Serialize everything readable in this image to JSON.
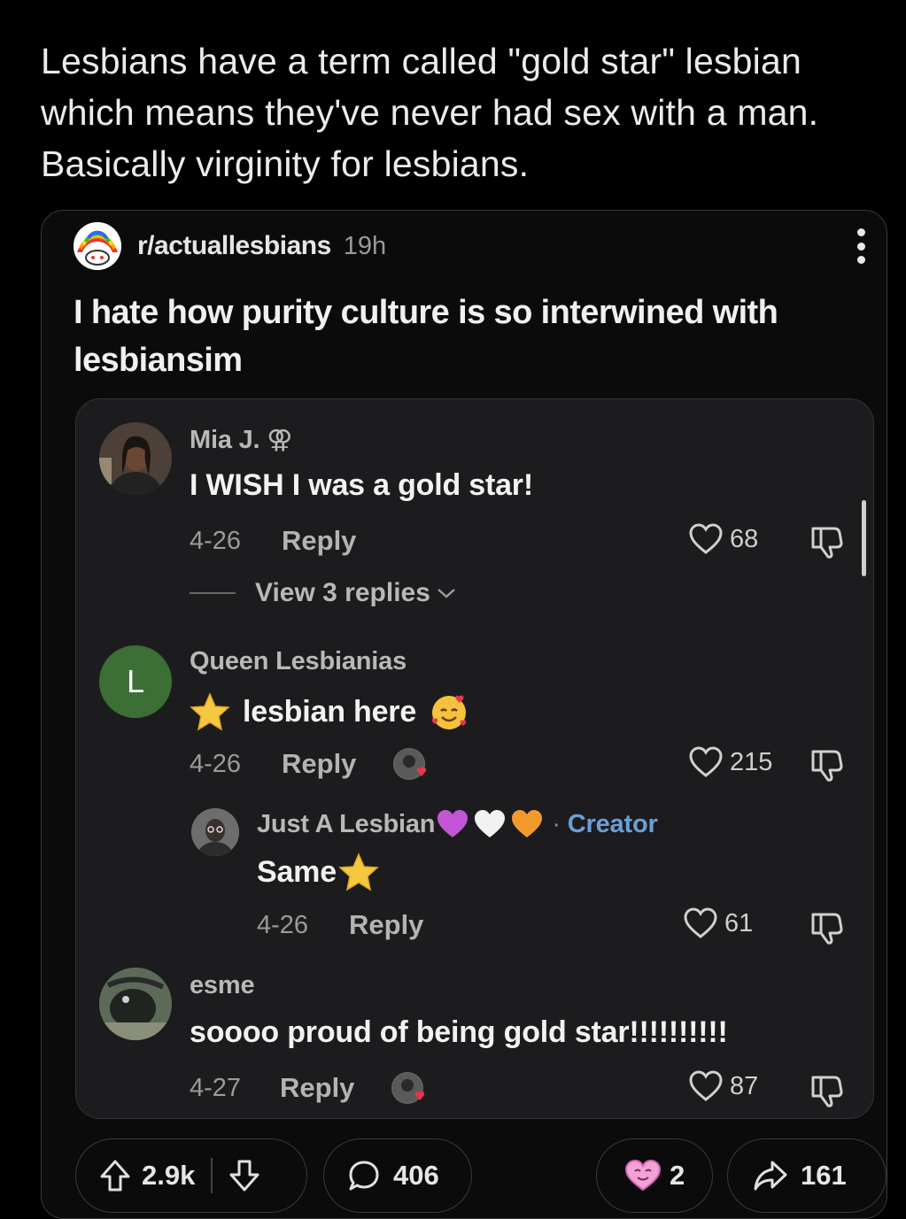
{
  "tweet": {
    "text": "Lesbians have a term called \"gold star\" lesbian which means they've never had sex with a man. Basically virginity for lesbians."
  },
  "post": {
    "subreddit": "r/actuallesbians",
    "time": "19h",
    "title": "I hate how purity culture is so interwined with lesbiansim"
  },
  "comments": [
    {
      "author": "Mia J. ⚢",
      "text": "I WISH I was a gold star!",
      "date": "4-26",
      "reply_label": "Reply",
      "likes": "68",
      "view_replies": "View 3 replies"
    },
    {
      "author": "Queen Lesbianias",
      "avatar_letter": "L",
      "text": "lesbian here",
      "date": "4-26",
      "reply_label": "Reply",
      "likes": "215"
    },
    {
      "author": "Just A Lesbian",
      "creator_label": "Creator",
      "separator": "·",
      "text": "Same",
      "date": "4-26",
      "reply_label": "Reply",
      "likes": "61"
    },
    {
      "author": "esme",
      "text": "soooo proud of being gold star!!!!!!!!!!",
      "date": "4-27",
      "reply_label": "Reply",
      "likes": "87"
    }
  ],
  "actions": {
    "upvotes": "2.9k",
    "comments": "406",
    "awards": "2",
    "shares": "161"
  },
  "colors": {
    "background": "#000000",
    "card": "#0b0b0c",
    "thread": "#1c1c1e",
    "creator": "#6aa0d8",
    "avatar_green": "#3b6f35"
  }
}
